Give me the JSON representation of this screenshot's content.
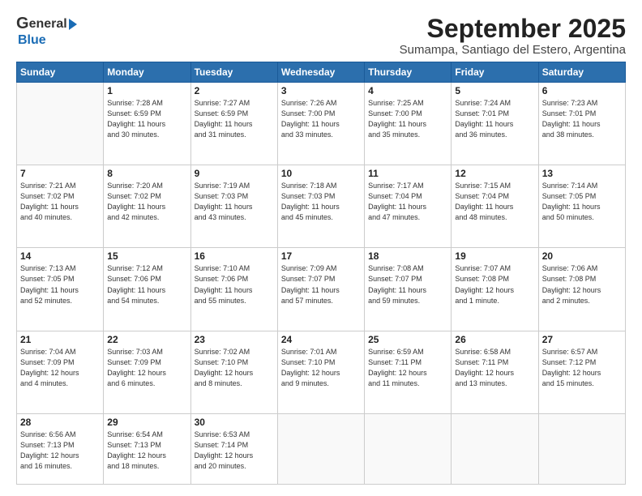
{
  "header": {
    "logo_general": "General",
    "logo_blue": "Blue",
    "title": "September 2025",
    "subtitle": "Sumampa, Santiago del Estero, Argentina"
  },
  "calendar": {
    "days_of_week": [
      "Sunday",
      "Monday",
      "Tuesday",
      "Wednesday",
      "Thursday",
      "Friday",
      "Saturday"
    ],
    "weeks": [
      [
        {
          "day": "",
          "info": ""
        },
        {
          "day": "1",
          "info": "Sunrise: 7:28 AM\nSunset: 6:59 PM\nDaylight: 11 hours\nand 30 minutes."
        },
        {
          "day": "2",
          "info": "Sunrise: 7:27 AM\nSunset: 6:59 PM\nDaylight: 11 hours\nand 31 minutes."
        },
        {
          "day": "3",
          "info": "Sunrise: 7:26 AM\nSunset: 7:00 PM\nDaylight: 11 hours\nand 33 minutes."
        },
        {
          "day": "4",
          "info": "Sunrise: 7:25 AM\nSunset: 7:00 PM\nDaylight: 11 hours\nand 35 minutes."
        },
        {
          "day": "5",
          "info": "Sunrise: 7:24 AM\nSunset: 7:01 PM\nDaylight: 11 hours\nand 36 minutes."
        },
        {
          "day": "6",
          "info": "Sunrise: 7:23 AM\nSunset: 7:01 PM\nDaylight: 11 hours\nand 38 minutes."
        }
      ],
      [
        {
          "day": "7",
          "info": "Sunrise: 7:21 AM\nSunset: 7:02 PM\nDaylight: 11 hours\nand 40 minutes."
        },
        {
          "day": "8",
          "info": "Sunrise: 7:20 AM\nSunset: 7:02 PM\nDaylight: 11 hours\nand 42 minutes."
        },
        {
          "day": "9",
          "info": "Sunrise: 7:19 AM\nSunset: 7:03 PM\nDaylight: 11 hours\nand 43 minutes."
        },
        {
          "day": "10",
          "info": "Sunrise: 7:18 AM\nSunset: 7:03 PM\nDaylight: 11 hours\nand 45 minutes."
        },
        {
          "day": "11",
          "info": "Sunrise: 7:17 AM\nSunset: 7:04 PM\nDaylight: 11 hours\nand 47 minutes."
        },
        {
          "day": "12",
          "info": "Sunrise: 7:15 AM\nSunset: 7:04 PM\nDaylight: 11 hours\nand 48 minutes."
        },
        {
          "day": "13",
          "info": "Sunrise: 7:14 AM\nSunset: 7:05 PM\nDaylight: 11 hours\nand 50 minutes."
        }
      ],
      [
        {
          "day": "14",
          "info": "Sunrise: 7:13 AM\nSunset: 7:05 PM\nDaylight: 11 hours\nand 52 minutes."
        },
        {
          "day": "15",
          "info": "Sunrise: 7:12 AM\nSunset: 7:06 PM\nDaylight: 11 hours\nand 54 minutes."
        },
        {
          "day": "16",
          "info": "Sunrise: 7:10 AM\nSunset: 7:06 PM\nDaylight: 11 hours\nand 55 minutes."
        },
        {
          "day": "17",
          "info": "Sunrise: 7:09 AM\nSunset: 7:07 PM\nDaylight: 11 hours\nand 57 minutes."
        },
        {
          "day": "18",
          "info": "Sunrise: 7:08 AM\nSunset: 7:07 PM\nDaylight: 11 hours\nand 59 minutes."
        },
        {
          "day": "19",
          "info": "Sunrise: 7:07 AM\nSunset: 7:08 PM\nDaylight: 12 hours\nand 1 minute."
        },
        {
          "day": "20",
          "info": "Sunrise: 7:06 AM\nSunset: 7:08 PM\nDaylight: 12 hours\nand 2 minutes."
        }
      ],
      [
        {
          "day": "21",
          "info": "Sunrise: 7:04 AM\nSunset: 7:09 PM\nDaylight: 12 hours\nand 4 minutes."
        },
        {
          "day": "22",
          "info": "Sunrise: 7:03 AM\nSunset: 7:09 PM\nDaylight: 12 hours\nand 6 minutes."
        },
        {
          "day": "23",
          "info": "Sunrise: 7:02 AM\nSunset: 7:10 PM\nDaylight: 12 hours\nand 8 minutes."
        },
        {
          "day": "24",
          "info": "Sunrise: 7:01 AM\nSunset: 7:10 PM\nDaylight: 12 hours\nand 9 minutes."
        },
        {
          "day": "25",
          "info": "Sunrise: 6:59 AM\nSunset: 7:11 PM\nDaylight: 12 hours\nand 11 minutes."
        },
        {
          "day": "26",
          "info": "Sunrise: 6:58 AM\nSunset: 7:11 PM\nDaylight: 12 hours\nand 13 minutes."
        },
        {
          "day": "27",
          "info": "Sunrise: 6:57 AM\nSunset: 7:12 PM\nDaylight: 12 hours\nand 15 minutes."
        }
      ],
      [
        {
          "day": "28",
          "info": "Sunrise: 6:56 AM\nSunset: 7:13 PM\nDaylight: 12 hours\nand 16 minutes."
        },
        {
          "day": "29",
          "info": "Sunrise: 6:54 AM\nSunset: 7:13 PM\nDaylight: 12 hours\nand 18 minutes."
        },
        {
          "day": "30",
          "info": "Sunrise: 6:53 AM\nSunset: 7:14 PM\nDaylight: 12 hours\nand 20 minutes."
        },
        {
          "day": "",
          "info": ""
        },
        {
          "day": "",
          "info": ""
        },
        {
          "day": "",
          "info": ""
        },
        {
          "day": "",
          "info": ""
        }
      ]
    ]
  }
}
